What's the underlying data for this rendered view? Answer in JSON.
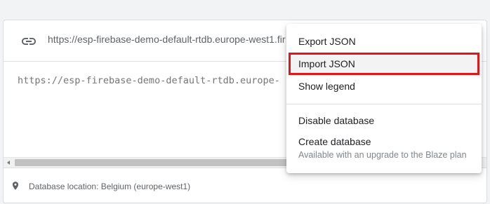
{
  "database_panel": {
    "url": "https://esp-firebase-demo-default-rtdb.europe-west1.fir",
    "tree_root": "https://esp-firebase-demo-default-rtdb.europe-",
    "location": "Database location: Belgium (europe-west1)"
  },
  "menu": {
    "export_json": "Export JSON",
    "import_json": "Import JSON",
    "show_legend": "Show legend",
    "disable_database": "Disable database",
    "create_database": "Create database",
    "create_database_note": "Available with an upgrade to the Blaze plan"
  },
  "colors": {
    "highlight_outline": "#e0161e",
    "menu_background": "#ffffff"
  },
  "icons": {
    "url": "link-icon",
    "location": "location-pin-icon"
  }
}
